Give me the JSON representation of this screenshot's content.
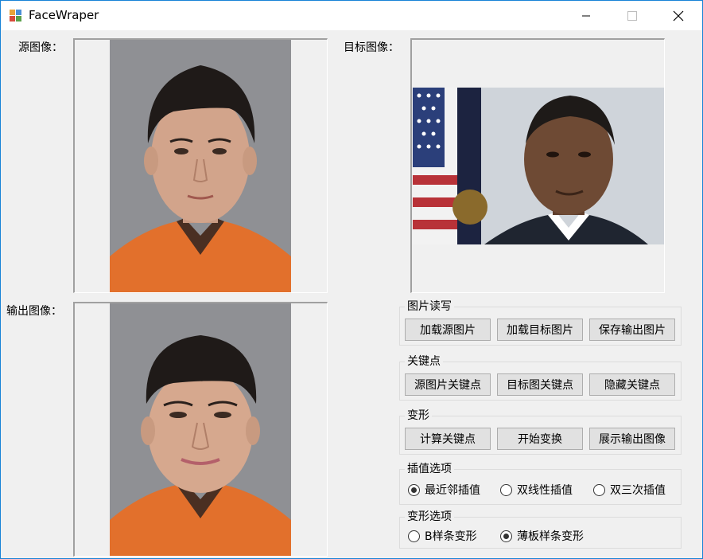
{
  "window": {
    "title": "FaceWraper"
  },
  "labels": {
    "source": "源图像：",
    "target": "目标图像：",
    "output": "输出图像："
  },
  "groups": {
    "io": {
      "title": "图片读写",
      "buttons": [
        "加载源图片",
        "加载目标图片",
        "保存输出图片"
      ]
    },
    "keypoints": {
      "title": "关键点",
      "buttons": [
        "源图片关键点",
        "目标图关键点",
        "隐藏关键点"
      ]
    },
    "transform": {
      "title": "变形",
      "buttons": [
        "计算关键点",
        "开始变换",
        "展示输出图像"
      ]
    },
    "interp": {
      "title": "插值选项",
      "options": [
        "最近邻插值",
        "双线性插值",
        "双三次插值"
      ],
      "selected": 0
    },
    "warp": {
      "title": "变形选项",
      "options": [
        "B样条变形",
        "薄板样条变形"
      ],
      "selected": 1
    }
  },
  "colors": {
    "accent": "#1883d7",
    "button_face": "#e1e1e1",
    "button_border": "#adadad",
    "shirt_orange": "#e2702c",
    "photo_bg_gray": "#8e8f93"
  },
  "icons": [
    "app-icon",
    "minimize-icon",
    "maximize-icon",
    "close-icon"
  ]
}
